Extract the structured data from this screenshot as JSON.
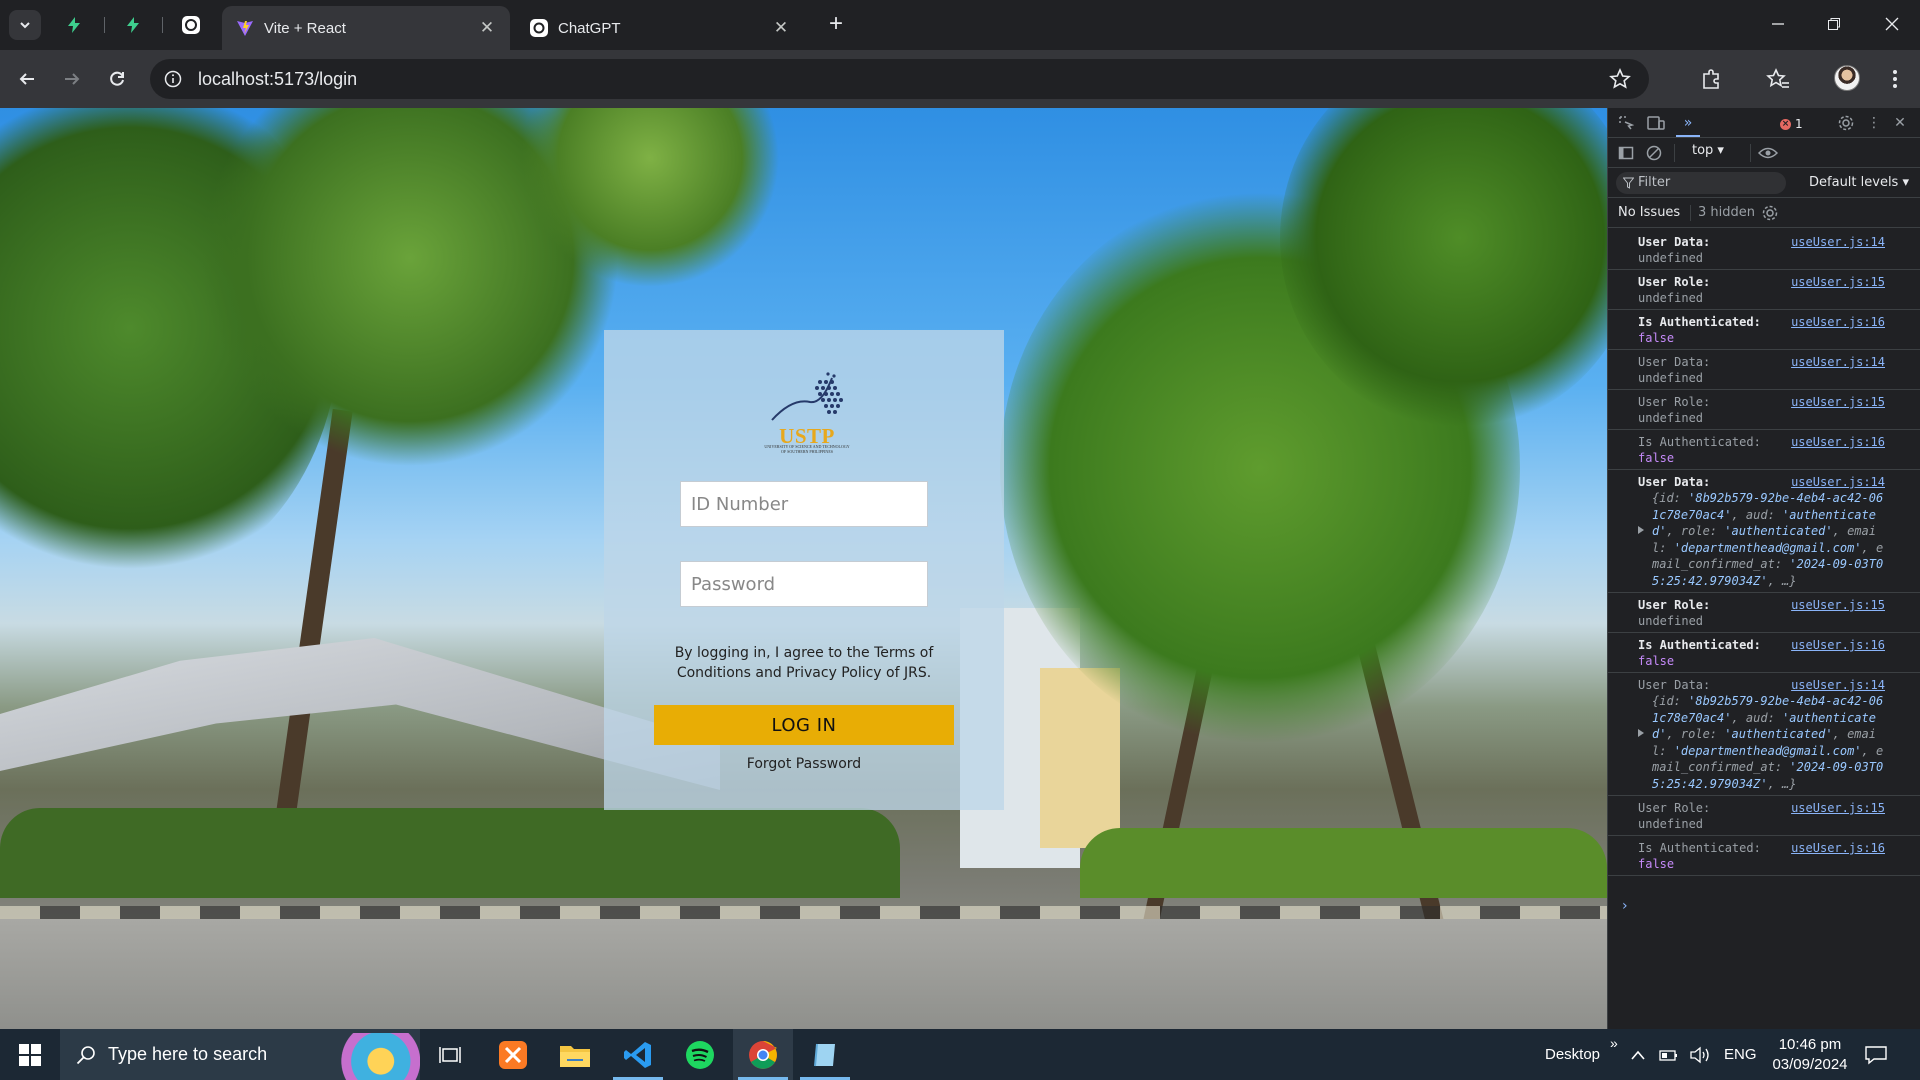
{
  "browser": {
    "tabs": [
      {
        "title": "Vite + React",
        "active": true
      },
      {
        "title": "ChatGPT",
        "active": false
      }
    ],
    "url": "localhost:5173/login"
  },
  "login": {
    "logo_text": "USTP",
    "logo_subtext": "UNIVERSITY OF SCIENCE AND TECHNOLOGY OF SOUTHERN PHILIPPINES",
    "id_placeholder": "ID Number",
    "password_placeholder": "Password",
    "terms": "By logging in, I agree to the Terms of Conditions and Privacy Policy of JRS.",
    "login_button": "LOG IN",
    "forgot": "Forgot Password"
  },
  "devtools": {
    "error_count": "1",
    "context": "top ▾",
    "filter": "Filter",
    "levels": "Default levels ▾",
    "issues": "No Issues",
    "hidden": "3 hidden",
    "logs": [
      {
        "label": "User Data:",
        "value": "undefined",
        "src": "useUser.js:14",
        "dim": false,
        "kind": "undef"
      },
      {
        "label": "User Role:",
        "value": "undefined",
        "src": "useUser.js:15",
        "dim": false,
        "kind": "undef"
      },
      {
        "label": "Is Authenticated:",
        "value": "false",
        "src": "useUser.js:16",
        "dim": false,
        "kind": "bool"
      },
      {
        "label": "User Data:",
        "value": "undefined",
        "src": "useUser.js:14",
        "dim": true,
        "kind": "undef"
      },
      {
        "label": "User Role:",
        "value": "undefined",
        "src": "useUser.js:15",
        "dim": true,
        "kind": "undef"
      },
      {
        "label": "Is Authenticated:",
        "value": "false",
        "src": "useUser.js:16",
        "dim": true,
        "kind": "bool"
      },
      {
        "label": "User Data:",
        "src": "useUser.js:14",
        "dim": false,
        "kind": "obj",
        "obj": {
          "id": "'8b92b579-92be-4eb4-ac42-061c78e70ac4'",
          "aud": "'authenticated'",
          "role": "'authenticated'",
          "email": "'departmenthead@gmail.com'",
          "confirmed": "'2024-09-03T05:25:42.979034Z'"
        }
      },
      {
        "label": "User Role:",
        "value": "undefined",
        "src": "useUser.js:15",
        "dim": false,
        "kind": "undef"
      },
      {
        "label": "Is Authenticated:",
        "value": "false",
        "src": "useUser.js:16",
        "dim": false,
        "kind": "bool"
      },
      {
        "label": "User Data:",
        "src": "useUser.js:14",
        "dim": true,
        "kind": "obj",
        "obj": {
          "id": "'8b92b579-92be-4eb4-ac42-061c78e70ac4'",
          "aud": "'authenticated'",
          "role": "'authenticated'",
          "email": "'departmenthead@gmail.com'",
          "confirmed": "'2024-09-03T05:25:42.979034Z'"
        }
      },
      {
        "label": "User Role:",
        "value": "undefined",
        "src": "useUser.js:15",
        "dim": true,
        "kind": "undef"
      },
      {
        "label": "Is Authenticated:",
        "value": "false",
        "src": "useUser.js:16",
        "dim": true,
        "kind": "bool"
      }
    ]
  },
  "taskbar": {
    "search": "Type here to search",
    "desktop": "Desktop",
    "lang": "ENG",
    "time": "10:46 pm",
    "date": "03/09/2024"
  }
}
